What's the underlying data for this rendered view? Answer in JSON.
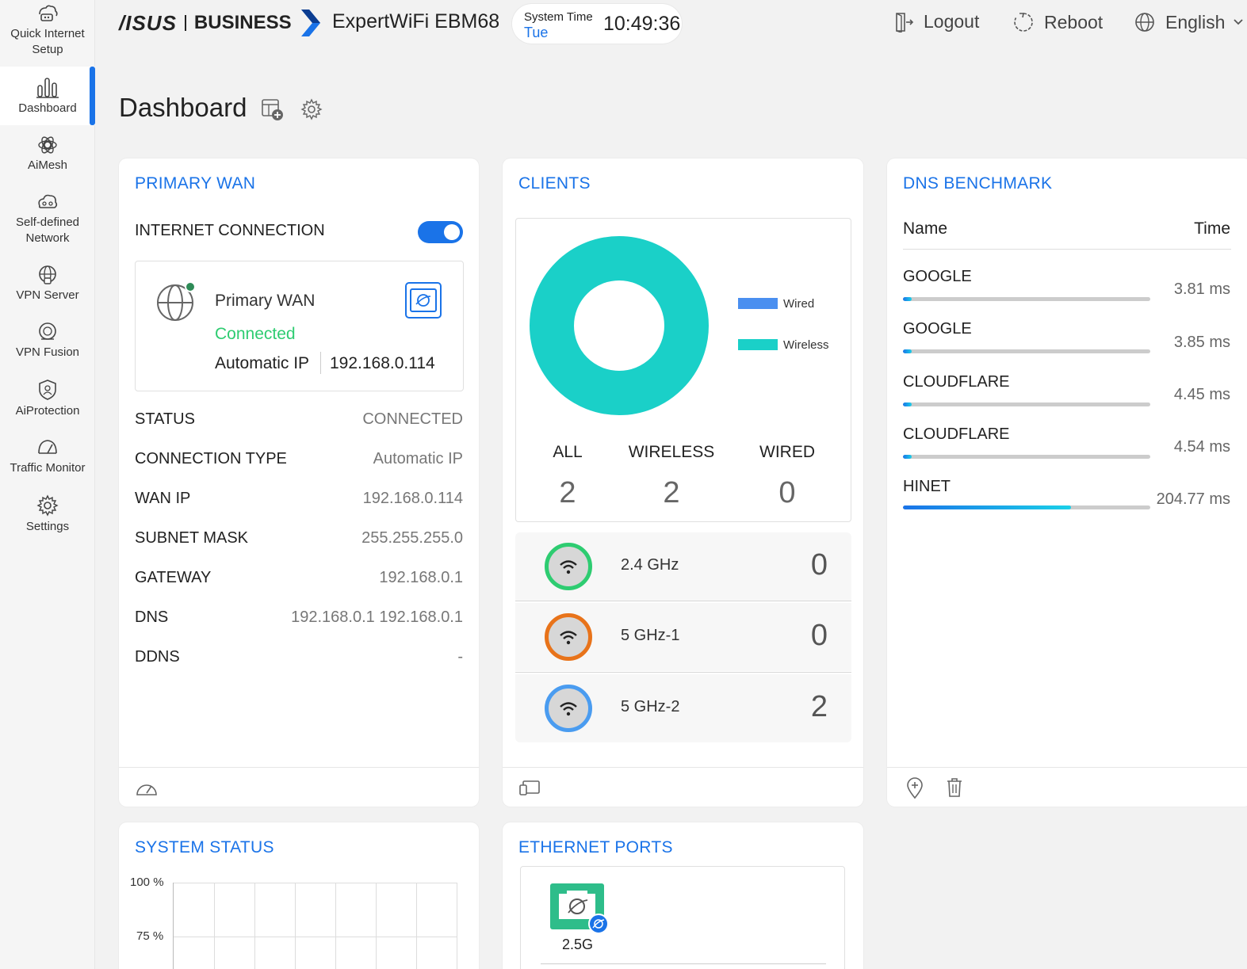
{
  "sidebar": {
    "items": [
      {
        "label": "Quick Internet Setup",
        "icon": "quick-setup-icon"
      },
      {
        "label": "Dashboard",
        "icon": "dashboard-icon"
      },
      {
        "label": "AiMesh",
        "icon": "aimesh-icon"
      },
      {
        "label": "Self-defined Network",
        "icon": "network-icon"
      },
      {
        "label": "VPN Server",
        "icon": "vpn-server-icon"
      },
      {
        "label": "VPN Fusion",
        "icon": "vpn-fusion-icon"
      },
      {
        "label": "AiProtection",
        "icon": "shield-icon"
      },
      {
        "label": "Traffic Monitor",
        "icon": "traffic-icon"
      },
      {
        "label": "Settings",
        "icon": "gear-icon"
      }
    ],
    "active_index": 1
  },
  "header": {
    "logo_brand": "/ISUS",
    "logo_business": "BUSINESS",
    "model": "ExpertWiFi EBM68",
    "system_time_label": "System Time",
    "system_time_day": "Tue",
    "system_time_value": "10:49:36",
    "logout_label": "Logout",
    "reboot_label": "Reboot",
    "language_label": "English"
  },
  "page": {
    "title": "Dashboard"
  },
  "colors": {
    "accent": "#1a73e8",
    "wireless": "#1ad0c8",
    "wired": "#4a8ff0",
    "connected": "#2ecc71",
    "band_24": "#2ecc71",
    "band_5_1": "#e8731a",
    "band_5_2": "#4a9cf0"
  },
  "primary_wan": {
    "title": "PRIMARY WAN",
    "internet_connection_label": "INTERNET CONNECTION",
    "internet_connection_on": true,
    "box_name": "Primary WAN",
    "box_status": "Connected",
    "box_type": "Automatic IP",
    "box_ip": "192.168.0.114",
    "rows": [
      {
        "label": "STATUS",
        "value": "CONNECTED"
      },
      {
        "label": "CONNECTION TYPE",
        "value": "Automatic IP"
      },
      {
        "label": "WAN IP",
        "value": "192.168.0.114"
      },
      {
        "label": "SUBNET MASK",
        "value": "255.255.255.0"
      },
      {
        "label": "GATEWAY",
        "value": "192.168.0.1"
      },
      {
        "label": "DNS",
        "value": "192.168.0.1 192.168.0.1"
      },
      {
        "label": "DDNS",
        "value": "-"
      }
    ]
  },
  "clients": {
    "title": "CLIENTS",
    "legend_wired": "Wired",
    "legend_wireless": "Wireless",
    "all_label": "ALL",
    "all_value": "2",
    "wireless_label": "WIRELESS",
    "wireless_value": "2",
    "wired_label": "WIRED",
    "wired_value": "0",
    "bands": [
      {
        "name": "2.4 GHz",
        "count": "0"
      },
      {
        "name": "5 GHz-1",
        "count": "0"
      },
      {
        "name": "5 GHz-2",
        "count": "2"
      }
    ]
  },
  "dns_benchmark": {
    "title": "DNS BENCHMARK",
    "col_name": "Name",
    "col_time": "Time",
    "rows": [
      {
        "name": "GOOGLE",
        "time": "3.81 ms",
        "ms": 3.81
      },
      {
        "name": "GOOGLE",
        "time": "3.85 ms",
        "ms": 3.85
      },
      {
        "name": "CLOUDFLARE",
        "time": "4.45 ms",
        "ms": 4.45
      },
      {
        "name": "CLOUDFLARE",
        "time": "4.54 ms",
        "ms": 4.54
      },
      {
        "name": "HINET",
        "time": "204.77 ms",
        "ms": 204.77
      }
    ]
  },
  "system_status": {
    "title": "SYSTEM STATUS",
    "y_tick_100": "100 %",
    "y_tick_75": "75 %"
  },
  "ethernet_ports": {
    "title": "ETHERNET PORTS",
    "port_label": "2.5G"
  }
}
